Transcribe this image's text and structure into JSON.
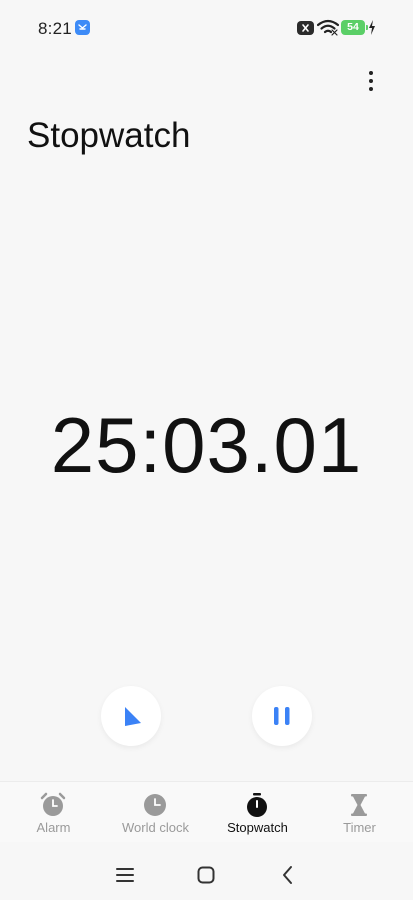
{
  "status_bar": {
    "time": "8:21",
    "battery_level": "54"
  },
  "header": {
    "title": "Stopwatch",
    "more_icon": "more-vertical-icon"
  },
  "stopwatch": {
    "elapsed": "25:03.01",
    "lap_icon": "flag-icon",
    "pause_icon": "pause-icon",
    "accent_color": "#3b82f6"
  },
  "bottom_nav": {
    "tabs": [
      {
        "label": "Alarm",
        "icon": "alarm-clock-icon",
        "active": false
      },
      {
        "label": "World clock",
        "icon": "clock-icon",
        "active": false
      },
      {
        "label": "Stopwatch",
        "icon": "stopwatch-icon",
        "active": true
      },
      {
        "label": "Timer",
        "icon": "hourglass-icon",
        "active": false
      }
    ]
  },
  "system_nav": {
    "icons": [
      "recents-icon",
      "home-icon",
      "back-icon"
    ]
  }
}
